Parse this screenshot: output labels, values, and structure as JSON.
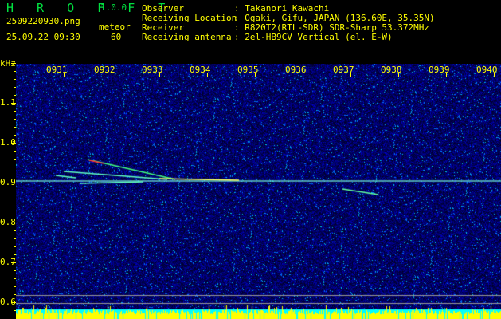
{
  "app": {
    "name": "H R O F F T",
    "version": "1.0.0"
  },
  "file": {
    "name": "2509220930.png",
    "datetime": "25.09.22 09:30"
  },
  "meteor": {
    "label": "meteor",
    "count": "60"
  },
  "info": [
    {
      "label": "Observer",
      "value": "Takanori Kawachi"
    },
    {
      "label": "Receiving Location",
      "value": "Ogaki, Gifu, JAPAN (136.60E, 35.35N)"
    },
    {
      "label": "Receiver",
      "value": "R820T2(RTL-SDR) SDR-Sharp 53.372MHz"
    },
    {
      "label": "Receiving antenna",
      "value": "2el-HB9CV Vertical (el. E-W)"
    }
  ],
  "axis": {
    "unit": "kHz",
    "y_ticks": [
      "1.1",
      "1.0",
      "0.9",
      "0.8",
      "0.7",
      "0.6"
    ],
    "x_ticks": [
      "0931",
      "0932",
      "0933",
      "0934",
      "0935",
      "0936",
      "0937",
      "0938",
      "0939",
      "0940"
    ]
  },
  "colors": {
    "text": "#ffff00",
    "logo": "#00e040",
    "bars": "#ffff00",
    "baseline": "#00ffff"
  }
}
